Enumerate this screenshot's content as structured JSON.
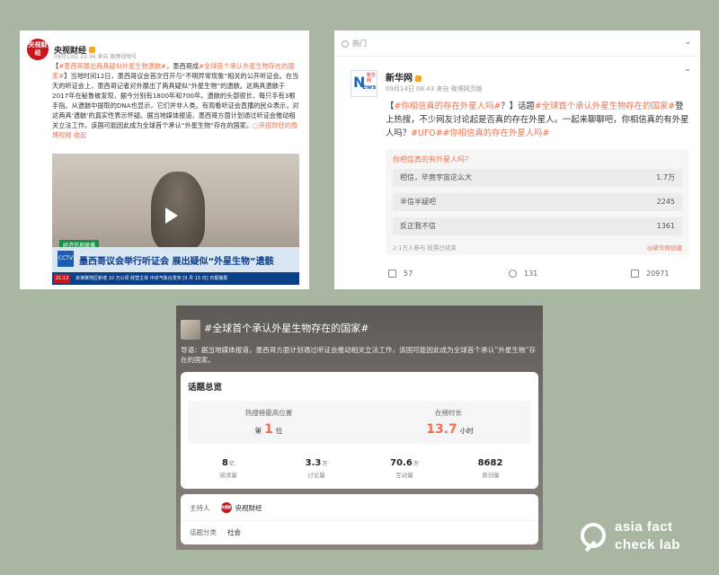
{
  "post1": {
    "logo_text": "央视财经",
    "name": "央视财经",
    "meta": "09月13日 22:34  来自 微博视频号",
    "text_bracket_open": "【",
    "hashtag": "#墨西哥展出两具疑似外星生物遗骸#",
    "text_a": "，墨西哥成",
    "hashtag2": "#全球首个承认外星生物存在的国家#",
    "text_b": "】当地时间12日，墨西哥议会首次召开与“不明异常现象”相关的公开听证会。在当天的听证会上，墨西哥记者对外展出了两具疑似“外星生物”的遗骸。这两具遗骸于2017年在秘鲁被发现，据今分别有1800年和700年。遗骸的头部很长，每只手有3根手指。从遗骸中提取的DNA也显示，它们并非人类。有观看听证会直播的民众表示，对这两具‘遗骸’的真实性表示怀疑。据当地媒体报道，墨西哥方面计划通过听证会推动相关立法工作。该国可能因此成为全球首个承认“外星生物”存在的国家。",
    "video_link": "□央视财经的微博视频",
    "collapse": "收起",
    "video": {
      "tag": "经济信息联播",
      "badge": "CCTV",
      "title": "墨西哥议会举行听证会 展出疑似“外星生物”遗骸",
      "time": "21:12",
      "ticker": "京津冀地区新增 10 万公顷 经营主体  中央气象台发布  [9 月 13 日] 日报播报"
    }
  },
  "post2": {
    "hot_label": "热门",
    "chevron": "⌄",
    "logo_n": "N",
    "logo_w": "ews",
    "logo_cn": "新华网",
    "name": "新华网",
    "meta": "09月14日 08:43  来自 微博网页版",
    "text_open": "【",
    "hashtag1": "#你相信真的存在外星人吗#",
    "text_a": "？】话题",
    "hashtag2": "#全球首个承认外星生物存在的国家#",
    "text_b": "登上热搜，不少网友讨论起是否真的存在外星人。一起来聊聊吧，你相信真的有外星人吗？",
    "hashtag3": "#UFO#",
    "hashtag4": "#你相信真的存在外星人吗#",
    "poll": {
      "title": "你相信真的有外星人吗？",
      "options": [
        {
          "label": "相信，毕竟宇宙这么大",
          "value": "1.7万"
        },
        {
          "label": "半信半疑吧",
          "value": "2245"
        },
        {
          "label": "反正我不信",
          "value": "1361"
        }
      ],
      "footer": "2.1万人参与  投票已结束",
      "by": "@新华网创建"
    },
    "actions": {
      "share": "57",
      "comment": "131",
      "like": "20971"
    }
  },
  "topic": {
    "title": "#全球首个承认外星生物存在的国家#",
    "guide": "导语：据当地媒体报道，墨西哥方面计划通过听证会推动相关立法工作，该国可能因此成为全球首个承认“外星生物”存在的国家。",
    "overview_title": "话题总览",
    "peak_label": "热搜榜最高位置",
    "peak_prefix": "第",
    "peak_value": "1",
    "peak_suffix": "位",
    "duration_label": "在榜时长",
    "duration_value": "13.7",
    "duration_unit": "小时",
    "stats": [
      {
        "num": "8",
        "unit": "亿",
        "label": "阅读量"
      },
      {
        "num": "3.3",
        "unit": "万",
        "label": "讨论量"
      },
      {
        "num": "70.6",
        "unit": "万",
        "label": "互动量"
      },
      {
        "num": "8682",
        "unit": "",
        "label": "原创量"
      }
    ],
    "host_label": "主持人",
    "host_logo": "央视财经",
    "host_name": "央视财经",
    "category_label": "话题分类",
    "category_value": "社会"
  },
  "watermark": {
    "line1": "asia fact",
    "line2": "check lab"
  }
}
